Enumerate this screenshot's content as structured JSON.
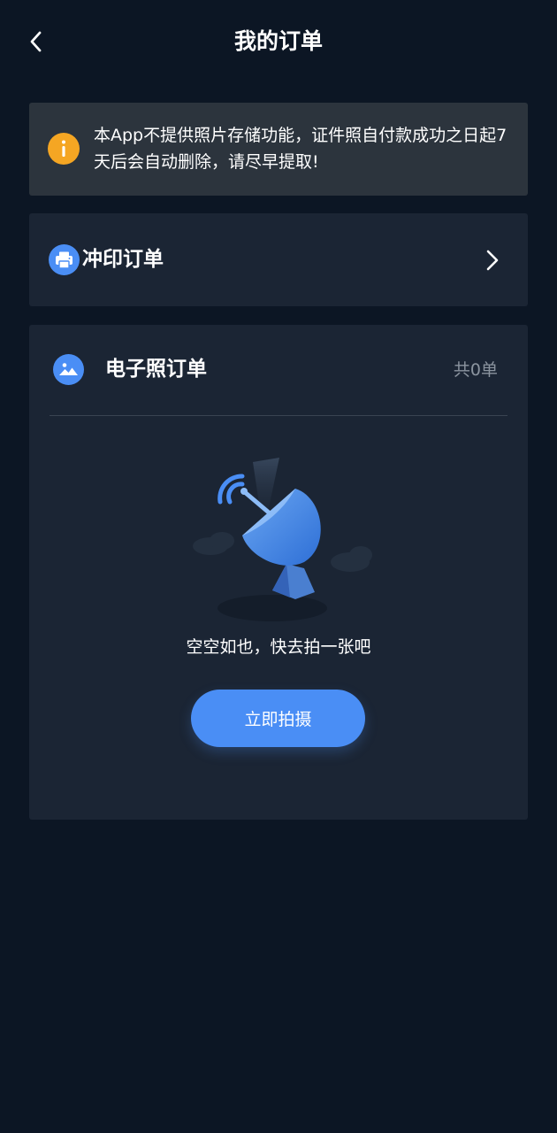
{
  "header": {
    "title": "我的订单",
    "back_icon": "chevron-left-icon"
  },
  "notice": {
    "icon": "info-icon",
    "icon_color": "#f5a623",
    "text": "本App不提供照片存储功能，证件照自付款成功之日起7天后会自动删除，请尽早提取!"
  },
  "print_orders": {
    "icon": "printer-icon",
    "label": "冲印订单",
    "chevron": "chevron-right-icon"
  },
  "photo_orders": {
    "icon": "image-icon",
    "label": "电子照订单",
    "count": "共0单",
    "empty_text": "空空如也，快去拍一张吧",
    "button_label": "立即拍摄"
  },
  "colors": {
    "background": "#0c1624",
    "card": "#1b2534",
    "notice_bg": "#2c343d",
    "accent": "#4a8ef5",
    "muted_text": "#8b949f"
  }
}
